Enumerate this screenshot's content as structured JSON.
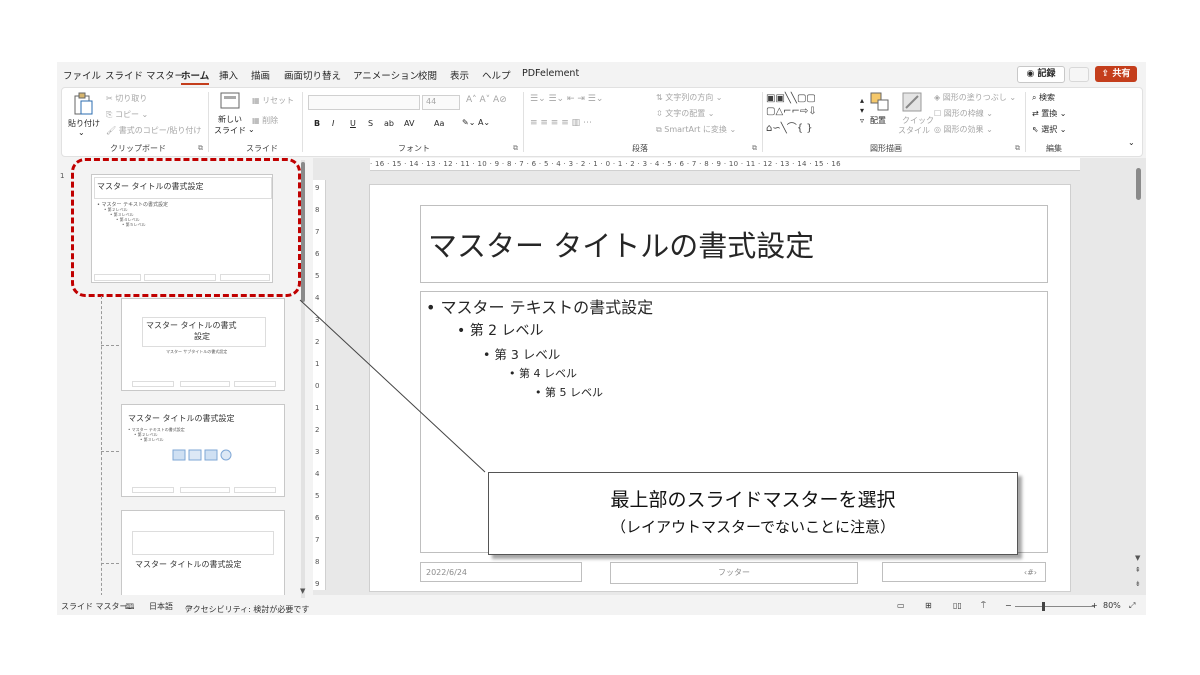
{
  "tabs": [
    "ファイル",
    "スライド マスター",
    "ホーム",
    "挿入",
    "描画",
    "画面切り替え",
    "アニメーション",
    "校閲",
    "表示",
    "ヘルプ",
    "PDFelement"
  ],
  "active_tab": "ホーム",
  "record_label": "記録",
  "share_label": "共有",
  "ribbon": {
    "clipboard": {
      "paste": "貼り付け",
      "cut": "切り取り",
      "copy": "コピー",
      "format_painter": "書式のコピー/貼り付け",
      "group": "クリップボード"
    },
    "slides": {
      "new_slide_1": "新しい",
      "new_slide_2": "スライド",
      "reset": "リセット",
      "delete": "削除",
      "group": "スライド"
    },
    "font": {
      "size": "44",
      "bold": "B",
      "italic": "I",
      "underline": "U",
      "strike": "S",
      "shadow": "ab",
      "spacing": "AV",
      "case": "Aa",
      "group": "フォント"
    },
    "paragraph": {
      "text_direction": "文字列の方向",
      "align_text": "文字の配置",
      "smartart": "SmartArt に変換",
      "group": "段落"
    },
    "drawing": {
      "arrange": "配置",
      "quick_1": "クイック",
      "quick_2": "スタイル",
      "fill": "図形の塗りつぶし",
      "outline": "図形の枠線",
      "effects": "図形の効果",
      "group": "図形描画"
    },
    "editing": {
      "find": "検索",
      "replace": "置換",
      "select": "選択",
      "group": "編集"
    }
  },
  "thumbnails": {
    "number": "1",
    "master_title": "マスター タイトルの書式設定",
    "master_text": "• マスター テキストの書式設定",
    "level2": "• 第２レベル",
    "level3": "• 第３レベル",
    "level4": "• 第４レベル",
    "level5": "• 第５レベル",
    "layout2_title_1": "マスター タイトルの書式",
    "layout2_title_2": "設定",
    "layout2_sub": "マスター サブタイトルの書式設定",
    "layout3_title": "マスター タイトルの書式設定",
    "layout4_title": "マスター タイトルの書式設定"
  },
  "ruler": {
    "horizontal": "· 16 · 15 · 14 · 13 · 12 · 11 · 10 · 9 · 8 · 7 · 6 · 5 · 4 · 3 · 2 · 1 · 0 · 1 · 2 · 3 · 4 · 5 · 6 · 7 · 8 · 9 · 10 · 11 · 12 · 13 · 14 · 15 · 16",
    "vertical": [
      "9",
      "8",
      "7",
      "6",
      "5",
      "4",
      "3",
      "2",
      "1",
      "0",
      "1",
      "2",
      "3",
      "4",
      "5",
      "6",
      "7",
      "8",
      "9"
    ]
  },
  "slide": {
    "title": "マスター タイトルの書式設定",
    "levels": [
      "• マスター テキストの書式設定",
      "• 第 2 レベル",
      "• 第 3 レベル",
      "• 第 4 レベル",
      "• 第 5 レベル"
    ],
    "date": "2022/6/24",
    "footer": "フッター",
    "page_number": "‹#›"
  },
  "callout": {
    "line1": "最上部のスライドマスターを選択",
    "line2": "（レイアウトマスターでないことに注意）"
  },
  "status": {
    "view": "スライド マスター",
    "language": "日本語",
    "accessibility": "アクセシビリティ: 検討が必要です",
    "zoom": "80%"
  }
}
